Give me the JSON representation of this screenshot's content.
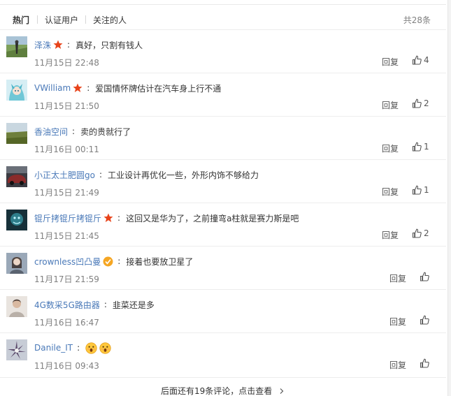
{
  "tabs": [
    {
      "label": "热门",
      "active": true
    },
    {
      "label": "认证用户",
      "active": false
    },
    {
      "label": "关注的人",
      "active": false
    }
  ],
  "total_count": "共28条",
  "reply_label": "回复",
  "comments": [
    {
      "user": "泽洙",
      "badge": "star",
      "text": "真好，只割有钱人",
      "time": "11月15日 22:48",
      "likes": "4"
    },
    {
      "user": "VWilliam",
      "badge": "star",
      "text": "爱国情怀牌估计在汽车身上行不通",
      "time": "11月15日 21:50",
      "likes": "2"
    },
    {
      "user": "香油空间",
      "badge": "",
      "text": "卖的贵就行了",
      "time": "11月16日 00:11",
      "likes": "1"
    },
    {
      "user": "小正太土肥圆go",
      "badge": "",
      "text": "工业设计再优化一些，外形内饰不够给力",
      "time": "11月15日 21:49",
      "likes": "1"
    },
    {
      "user": "锟斤拷锟斤拷锟斤",
      "badge": "star",
      "text": "这回又是华为了，之前撞弯a柱就是赛力斯是吧",
      "time": "11月15日 21:45",
      "likes": "2"
    },
    {
      "user": "crownless凹凸曼",
      "badge": "verified",
      "text": "接着也要放卫星了",
      "time": "11月17日 21:59",
      "likes": ""
    },
    {
      "user": "4G数采5G路由器",
      "badge": "",
      "text": "韭菜还是多",
      "time": "11月16日 16:47",
      "likes": ""
    },
    {
      "user": "Danile_IT",
      "badge": "",
      "text": "",
      "time": "11月16日 09:43",
      "likes": ""
    }
  ],
  "more_comments": "后面还有19条评论，点击查看",
  "colors": {
    "link": "#4a79b8",
    "star": "#e8431a",
    "verified": "#f5a623",
    "divider": "#ededed"
  },
  "icons": {
    "star_badge": "star-badge-icon",
    "verified_badge": "verified-badge-icon",
    "like": "thumbs-up-icon",
    "more_arrow": "chevron-right-icon",
    "emoji": "surprised-face-emoji-icon"
  }
}
